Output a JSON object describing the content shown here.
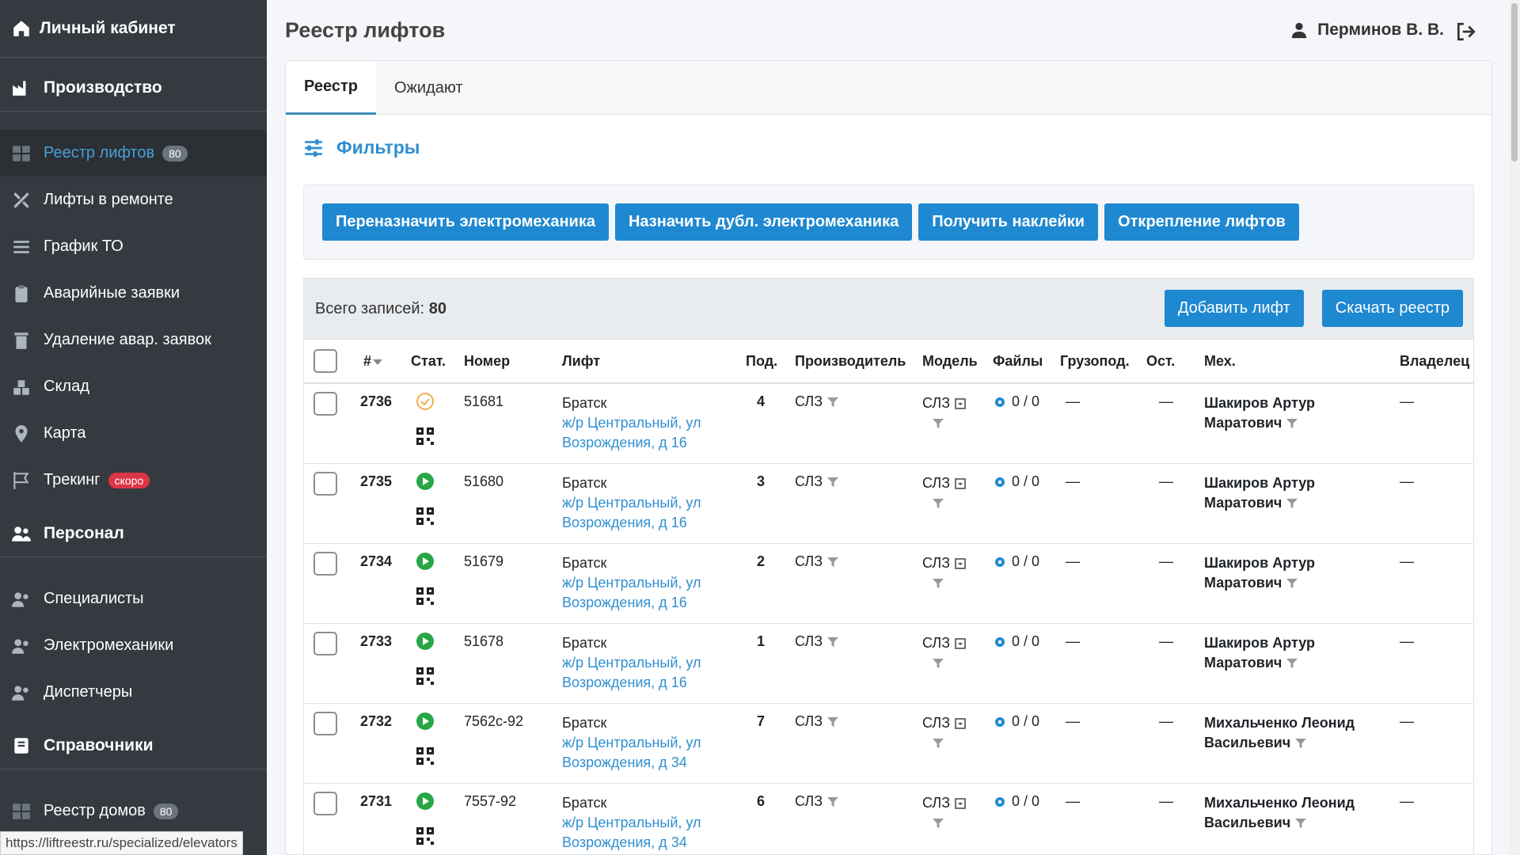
{
  "sidebar": {
    "brand": "Личный кабинет",
    "sections": {
      "production": "Производство",
      "personnel": "Персонал",
      "references": "Справочники"
    },
    "items": [
      {
        "label": "Реестр лифтов",
        "badge": "80",
        "icon": "grid-icon",
        "active": true
      },
      {
        "label": "Лифты в ремонте",
        "icon": "tools-icon"
      },
      {
        "label": "График ТО",
        "icon": "list-icon"
      },
      {
        "label": "Аварийные заявки",
        "icon": "clipboard-icon"
      },
      {
        "label": "Удаление авар. заявок",
        "icon": "trash-icon"
      },
      {
        "label": "Склад",
        "icon": "boxes-icon"
      },
      {
        "label": "Карта",
        "icon": "map-marker-icon"
      },
      {
        "label": "Трекинг",
        "badge": "скоро",
        "icon": "flag-icon"
      }
    ],
    "personnel_items": [
      {
        "label": "Специалисты",
        "icon": "users-icon"
      },
      {
        "label": "Электромеханики",
        "icon": "users-icon"
      },
      {
        "label": "Диспетчеры",
        "icon": "users-icon"
      }
    ],
    "references_item_partial": "Реестр домов",
    "references_item_badge": "80"
  },
  "header": {
    "title": "Реестр лифтов",
    "user": "Перминов В. В."
  },
  "tabs": [
    {
      "label": "Реестр",
      "active": true
    },
    {
      "label": "Ожидают",
      "active": false
    }
  ],
  "filters_label": "Фильтры",
  "actions": {
    "reassign": "Переназначить электромеханика",
    "assign_dup": "Назначить дубл. электромеханика",
    "stickers": "Получить наклейки",
    "detach": "Открепление лифтов"
  },
  "table": {
    "total_label": "Всего записей:",
    "total_value": "80",
    "add_button": "Добавить лифт",
    "download_button": "Скачать реестр",
    "columns": [
      "#",
      "Стат.",
      "Номер",
      "Лифт",
      "Под.",
      "Производитель",
      "Модель",
      "Файлы",
      "Грузопод.",
      "Ост.",
      "Мех.",
      "Владелец"
    ],
    "rows": [
      {
        "id": "2736",
        "status": "done",
        "number": "51681",
        "city": "Братск",
        "addr1": "ж/р Центральный, ул",
        "addr2": "Возрождения, д 16",
        "entrance": "4",
        "maker": "СЛЗ",
        "model": "СЛЗ",
        "files": "0 / 0",
        "load": "—",
        "stops": "—",
        "mech1": "Шакиров Артур",
        "mech2": "Маратович",
        "owner": "—"
      },
      {
        "id": "2735",
        "status": "active",
        "number": "51680",
        "city": "Братск",
        "addr1": "ж/р Центральный, ул",
        "addr2": "Возрождения, д 16",
        "entrance": "3",
        "maker": "СЛЗ",
        "model": "СЛЗ",
        "files": "0 / 0",
        "load": "—",
        "stops": "—",
        "mech1": "Шакиров Артур",
        "mech2": "Маратович",
        "owner": "—"
      },
      {
        "id": "2734",
        "status": "active",
        "number": "51679",
        "city": "Братск",
        "addr1": "ж/р Центральный, ул",
        "addr2": "Возрождения, д 16",
        "entrance": "2",
        "maker": "СЛЗ",
        "model": "СЛЗ",
        "files": "0 / 0",
        "load": "—",
        "stops": "—",
        "mech1": "Шакиров Артур",
        "mech2": "Маратович",
        "owner": "—"
      },
      {
        "id": "2733",
        "status": "active",
        "number": "51678",
        "city": "Братск",
        "addr1": "ж/р Центральный, ул",
        "addr2": "Возрождения, д 16",
        "entrance": "1",
        "maker": "СЛЗ",
        "model": "СЛЗ",
        "files": "0 / 0",
        "load": "—",
        "stops": "—",
        "mech1": "Шакиров Артур",
        "mech2": "Маратович",
        "owner": "—"
      },
      {
        "id": "2732",
        "status": "active",
        "number": "7562с-92",
        "city": "Братск",
        "addr1": "ж/р Центральный, ул",
        "addr2": "Возрождения, д 34",
        "entrance": "7",
        "maker": "СЛЗ",
        "model": "СЛЗ",
        "files": "0 / 0",
        "load": "—",
        "stops": "—",
        "mech1": "Михальченко Леонид",
        "mech2": "Васильевич",
        "owner": "—"
      },
      {
        "id": "2731",
        "status": "active",
        "number": "7557-92",
        "city": "Братск",
        "addr1": "ж/р Центральный, ул",
        "addr2": "Возрождения, д 34",
        "entrance": "6",
        "maker": "СЛЗ",
        "model": "СЛЗ",
        "files": "0 / 0",
        "load": "—",
        "stops": "—",
        "mech1": "Михальченко Леонид",
        "mech2": "Васильевич",
        "owner": "—"
      }
    ]
  },
  "status_url": "https://liftreestr.ru/specialized/elevators",
  "colors": {
    "sidebar": "#343a40",
    "accent": "#1e88d0",
    "link": "#2f8fd0",
    "green": "#28a745",
    "orange": "#f0ad4e"
  }
}
